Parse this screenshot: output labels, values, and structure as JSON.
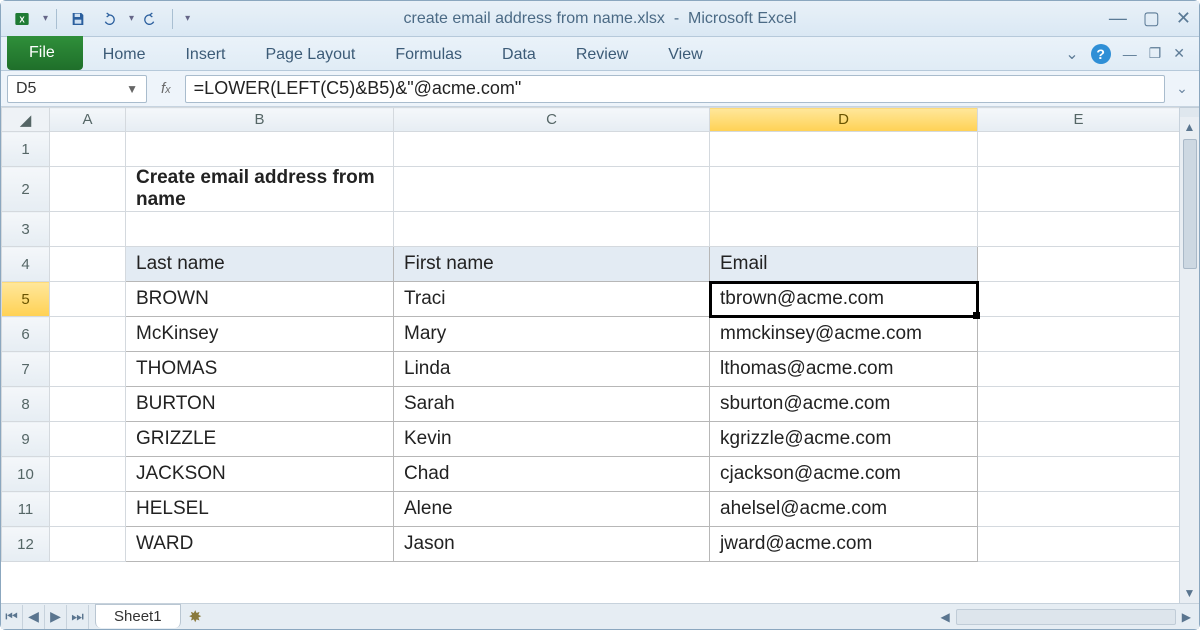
{
  "window": {
    "filename": "create email address from name.xlsx",
    "app": "Microsoft Excel"
  },
  "ribbon": {
    "file": "File",
    "tabs": [
      "Home",
      "Insert",
      "Page Layout",
      "Formulas",
      "Data",
      "Review",
      "View"
    ]
  },
  "name_box": "D5",
  "formula": "=LOWER(LEFT(C5)&B5)&\"@acme.com\"",
  "columns": [
    "A",
    "B",
    "C",
    "D",
    "E"
  ],
  "selected_col_index": 3,
  "selected_row": 5,
  "sheet_title": "Create email address from name",
  "headers": {
    "last": "Last name",
    "first": "First name",
    "email": "Email"
  },
  "rows": [
    {
      "r": 5,
      "last": "BROWN",
      "first": "Traci",
      "email": "tbrown@acme.com"
    },
    {
      "r": 6,
      "last": "McKinsey",
      "first": "Mary",
      "email": "mmckinsey@acme.com"
    },
    {
      "r": 7,
      "last": "THOMAS",
      "first": "Linda",
      "email": "lthomas@acme.com"
    },
    {
      "r": 8,
      "last": "BURTON",
      "first": "Sarah",
      "email": "sburton@acme.com"
    },
    {
      "r": 9,
      "last": "GRIZZLE",
      "first": "Kevin",
      "email": "kgrizzle@acme.com"
    },
    {
      "r": 10,
      "last": "JACKSON",
      "first": "Chad",
      "email": "cjackson@acme.com"
    },
    {
      "r": 11,
      "last": "HELSEL",
      "first": "Alene",
      "email": "ahelsel@acme.com"
    },
    {
      "r": 12,
      "last": "WARD",
      "first": "Jason",
      "email": "jward@acme.com"
    }
  ],
  "sheet_tab": "Sheet1",
  "chart_data": {
    "type": "table",
    "title": "Create email address from name",
    "columns": [
      "Last name",
      "First name",
      "Email"
    ],
    "rows": [
      [
        "BROWN",
        "Traci",
        "tbrown@acme.com"
      ],
      [
        "McKinsey",
        "Mary",
        "mmckinsey@acme.com"
      ],
      [
        "THOMAS",
        "Linda",
        "lthomas@acme.com"
      ],
      [
        "BURTON",
        "Sarah",
        "sburton@acme.com"
      ],
      [
        "GRIZZLE",
        "Kevin",
        "kgrizzle@acme.com"
      ],
      [
        "JACKSON",
        "Chad",
        "cjackson@acme.com"
      ],
      [
        "HELSEL",
        "Alene",
        "ahelsel@acme.com"
      ],
      [
        "WARD",
        "Jason",
        "jward@acme.com"
      ]
    ]
  }
}
